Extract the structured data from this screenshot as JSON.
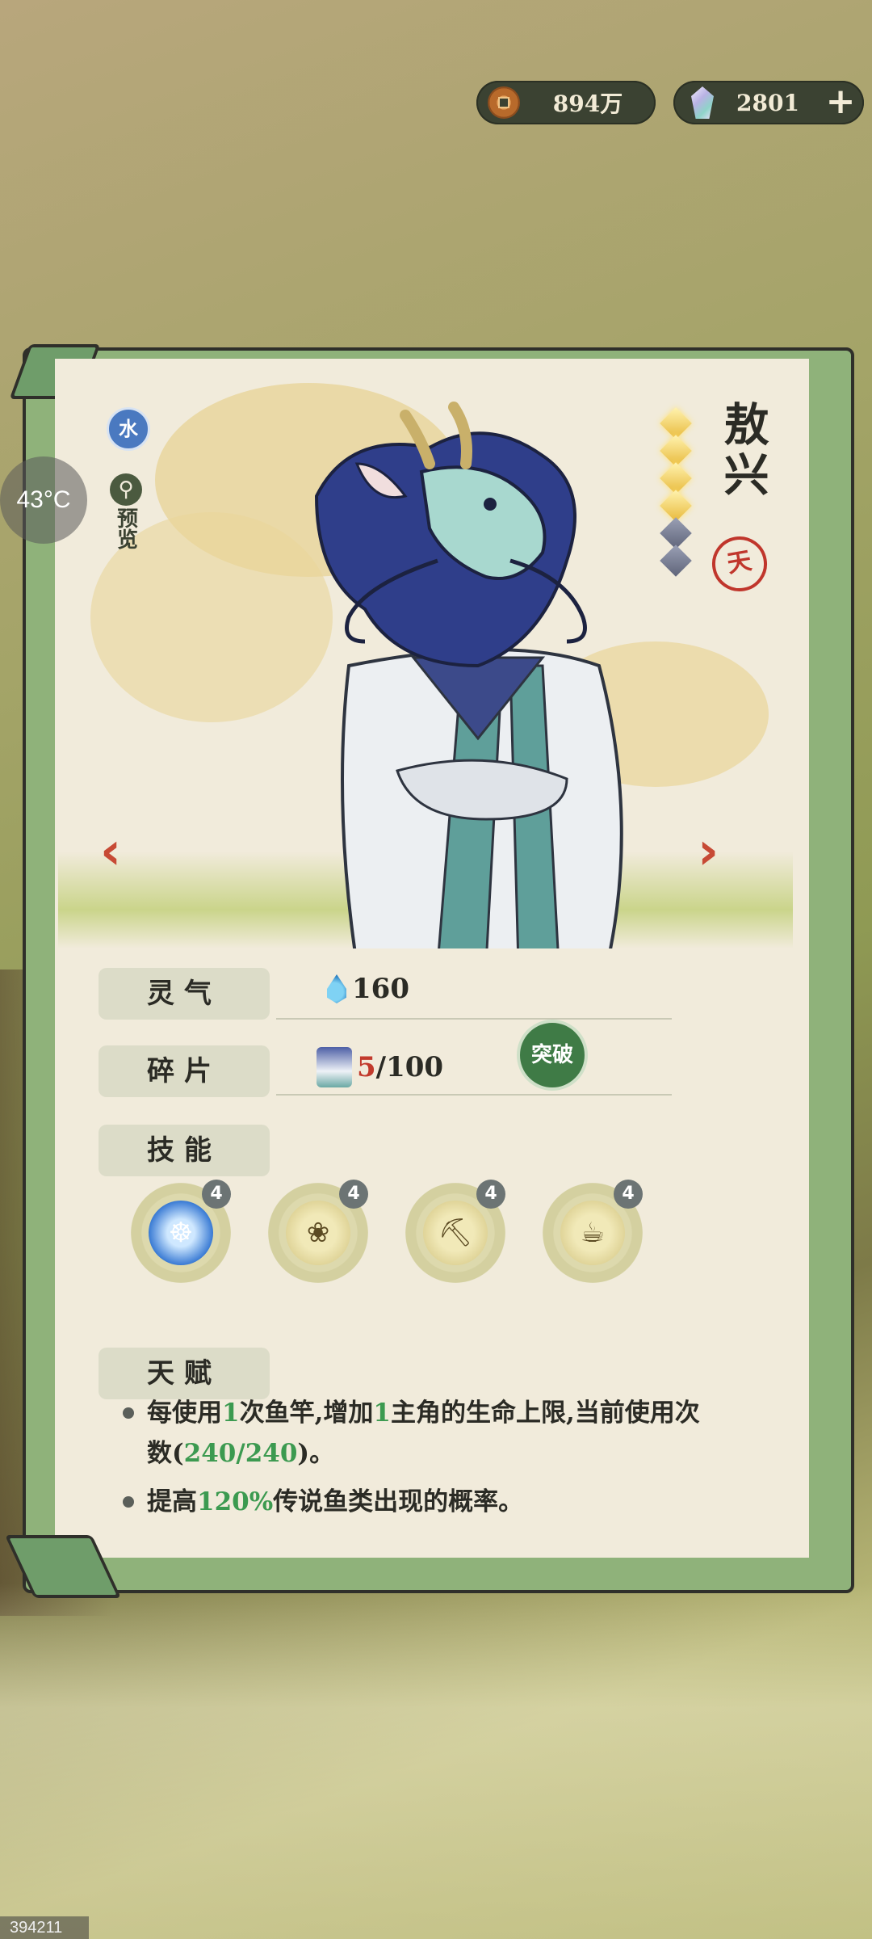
{
  "currency": {
    "coins": "894万",
    "gems": "2801",
    "add_label": "+"
  },
  "overlay": {
    "temperature": "43°C",
    "build_id": "394211"
  },
  "hero": {
    "element": "水",
    "preview_label": "预览",
    "name": "敖兴",
    "stars_filled": 4,
    "stars_total": 6,
    "rank_seal": "天"
  },
  "stats": {
    "aura_label": "灵气",
    "aura_value": "160",
    "fragment_label": "碎片",
    "fragment_current": "5",
    "fragment_total": "/100",
    "breakthrough_label": "突破",
    "skills_label": "技能",
    "talent_label": "天赋"
  },
  "skills": [
    {
      "level": "4",
      "icon": "dragon-icon"
    },
    {
      "level": "4",
      "icon": "reeds-icon"
    },
    {
      "level": "4",
      "icon": "shovel-icon"
    },
    {
      "level": "4",
      "icon": "bucket-icon"
    }
  ],
  "talents": [
    {
      "p1": "每使用",
      "h1": "1",
      "p2": "次鱼竿,增加",
      "h2": "1",
      "p3": "主角的生命上限,当前使用次数(",
      "h3": "240/240",
      "p4": ")。"
    },
    {
      "p1": "提高",
      "h1": "120%",
      "p2": "传说鱼类出现的概率。"
    }
  ],
  "colors": {
    "accent_red": "#c23a2c",
    "accent_green": "#3c9a50",
    "panel_paper": "#f1ebdb"
  }
}
